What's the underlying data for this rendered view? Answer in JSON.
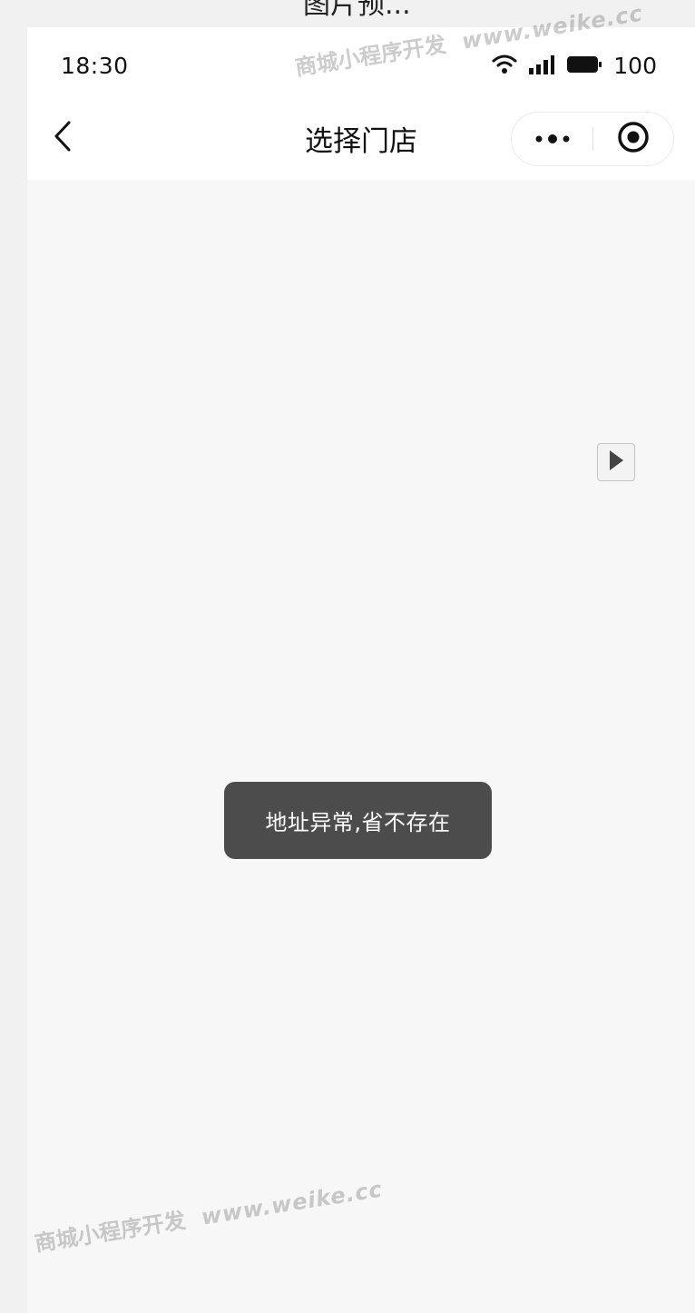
{
  "top_caption": "图片预...",
  "status_bar": {
    "time": "18:30",
    "battery": "100",
    "icons": [
      "wifi-icon",
      "signal-icon",
      "battery-icon"
    ]
  },
  "nav_bar": {
    "title": "选择门店",
    "back_icon": "chevron-left-icon",
    "more_icon": "more-dots-icon",
    "close_icon": "target-circle-icon"
  },
  "toast": {
    "message": "地址异常,省不存在"
  },
  "watermark": {
    "text": "商城小程序开发",
    "url": "www.weike.cc"
  },
  "colors": {
    "header_bg": "#ffffff",
    "page_bg": "#f7f7f7",
    "toast_bg": "#4c4c4c"
  }
}
